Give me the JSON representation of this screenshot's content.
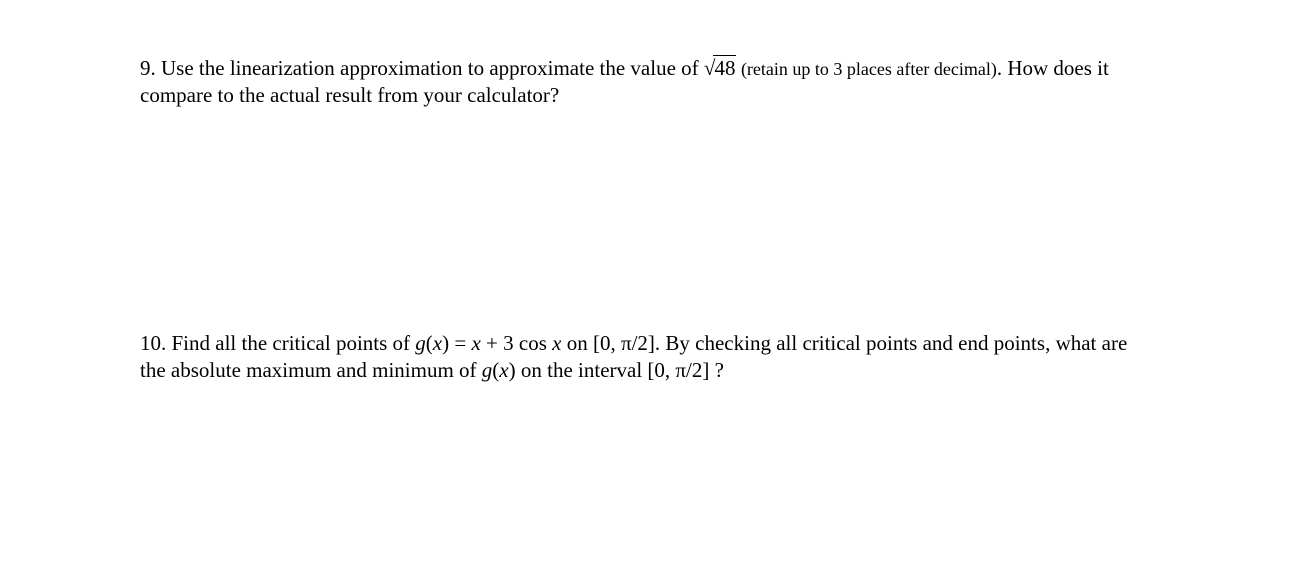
{
  "problems": {
    "p9": {
      "number": "9.",
      "part1": "Use the linearization approximation to approximate the value of ",
      "sqrt_symbol": "√",
      "sqrt_arg": "48",
      "part2_small": " (retain up to 3 places after decimal)",
      "part3": ". How does it compare to the actual result from your calculator?"
    },
    "p10": {
      "number": "10.",
      "part1": "Find all the critical points of ",
      "gx": "g",
      "open_paren": "(",
      "x": "x",
      "close_paren": ")",
      "equals": " = ",
      "rhs_x": "x",
      "plus": " + 3 cos ",
      "rhs_x2": "x",
      "on": " on ",
      "interval1": "[0, π/2]",
      "part2": ". By checking all critical points and end points, what are the absolute maximum and minimum of ",
      "gx2": "g",
      "open_paren2": "(",
      "x2": "x",
      "close_paren2": ")",
      "part3": " on the interval ",
      "interval2": "[0, π/2]",
      "qmark": " ?"
    }
  }
}
